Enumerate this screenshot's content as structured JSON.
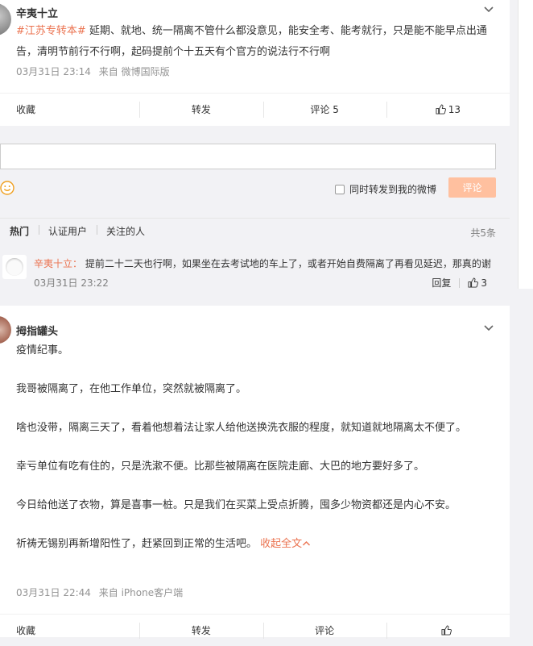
{
  "post1": {
    "username": "辛夷十立",
    "topic": "#江苏专转本#",
    "text": " 延期、就地、统一隔离不管什么都没意见，能安全考、能考就行，只是能不能早点出通告，清明节前行不行啊，起码提前个十五天有个官方的说法行不行啊",
    "time": "03月31日 23:14",
    "source": "来自 微博国际版",
    "actions": {
      "favorite": "收藏",
      "repost": "转发",
      "comment": "评论 5",
      "like_count": "13"
    }
  },
  "comment_box": {
    "forward_label": "同时转发到我的微博",
    "submit_label": "评论"
  },
  "comment_tabs": {
    "hot": "热门",
    "verified": "认证用户",
    "following": "关注的人",
    "total": "共5条"
  },
  "comment": {
    "username": "辛夷十立",
    "colon": "：",
    "text": " 提前二十二天也行啊，如果坐在去考试地的车上了，或者开始自费隔离了再看见延迟，那真的谢",
    "time": "03月31日 23:22",
    "reply_label": "回复",
    "like_count": "3"
  },
  "post2": {
    "username": "拇指罐头",
    "paragraphs": [
      "疫情纪事。",
      "我哥被隔离了，在他工作单位，突然就被隔离了。",
      "啥也没带，隔离三天了，看着他想着法让家人给他送换洗衣服的程度，就知道就地隔离太不便了。",
      "幸亏单位有吃有住的，只是洗漱不便。比那些被隔离在医院走廊、大巴的地方要好多了。",
      "今日给他送了衣物，算是喜事一桩。只是我们在买菜上受点折腾，囤多少物资都还是内心不安。",
      "祈祷无锡别再新增阳性了，赶紧回到正常的生活吧。"
    ],
    "collapse_label": "收起全文",
    "time": "03月31日 22:44",
    "source": "来自 iPhone客户端",
    "actions": {
      "favorite": "收藏",
      "repost": "转发",
      "comment": "评论"
    }
  },
  "right_panel": {
    "mark_top": "〈",
    "mark_bottom": "〈"
  },
  "icons": {
    "chevron": "chevron-down-icon",
    "thumb": "thumb-up-icon",
    "smiley": "smiley-icon"
  },
  "colors": {
    "accent": "#eb7350",
    "button_disabled": "#ffc09f",
    "meta_gray": "#939393"
  }
}
